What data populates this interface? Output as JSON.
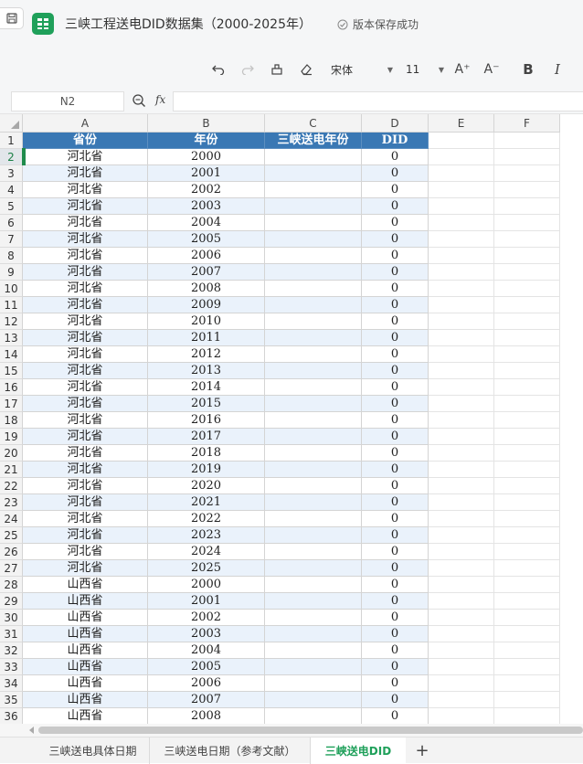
{
  "title_bar": {
    "doc_title": "三峡工程送电DID数据集（2000-2025年）",
    "save_status": "版本保存成功",
    "accent_color": "#1fa05a"
  },
  "toolbar": {
    "undo_icon": "undo-icon",
    "redo_icon": "redo-icon",
    "format_painter_icon": "format-painter-icon",
    "clear_format_icon": "eraser-icon",
    "font_name": "宋体",
    "font_size": "11",
    "increase_font_label": "A⁺",
    "decrease_font_label": "A⁻",
    "bold_label": "B",
    "italic_label": "I"
  },
  "formula_bar": {
    "cell_ref": "N2",
    "fx_label": "fx",
    "formula_value": ""
  },
  "grid": {
    "columns": [
      "A",
      "B",
      "C",
      "D",
      "E",
      "F"
    ],
    "rows": [
      "1",
      "2",
      "3",
      "4",
      "5",
      "6",
      "7",
      "8",
      "9",
      "10",
      "11",
      "12",
      "13",
      "14",
      "15",
      "16",
      "17",
      "18",
      "19",
      "20",
      "21",
      "22",
      "23",
      "24",
      "25",
      "26",
      "27",
      "28",
      "29",
      "30",
      "31",
      "32",
      "33",
      "34",
      "35",
      "36"
    ],
    "header_color": "#3a78b4",
    "stripe_color": "#eaf2fb",
    "header_row": [
      "省份",
      "年份",
      "三峡送电年份",
      "DID"
    ],
    "data": [
      [
        "河北省",
        "2000",
        "",
        "0"
      ],
      [
        "河北省",
        "2001",
        "",
        "0"
      ],
      [
        "河北省",
        "2002",
        "",
        "0"
      ],
      [
        "河北省",
        "2003",
        "",
        "0"
      ],
      [
        "河北省",
        "2004",
        "",
        "0"
      ],
      [
        "河北省",
        "2005",
        "",
        "0"
      ],
      [
        "河北省",
        "2006",
        "",
        "0"
      ],
      [
        "河北省",
        "2007",
        "",
        "0"
      ],
      [
        "河北省",
        "2008",
        "",
        "0"
      ],
      [
        "河北省",
        "2009",
        "",
        "0"
      ],
      [
        "河北省",
        "2010",
        "",
        "0"
      ],
      [
        "河北省",
        "2011",
        "",
        "0"
      ],
      [
        "河北省",
        "2012",
        "",
        "0"
      ],
      [
        "河北省",
        "2013",
        "",
        "0"
      ],
      [
        "河北省",
        "2014",
        "",
        "0"
      ],
      [
        "河北省",
        "2015",
        "",
        "0"
      ],
      [
        "河北省",
        "2016",
        "",
        "0"
      ],
      [
        "河北省",
        "2017",
        "",
        "0"
      ],
      [
        "河北省",
        "2018",
        "",
        "0"
      ],
      [
        "河北省",
        "2019",
        "",
        "0"
      ],
      [
        "河北省",
        "2020",
        "",
        "0"
      ],
      [
        "河北省",
        "2021",
        "",
        "0"
      ],
      [
        "河北省",
        "2022",
        "",
        "0"
      ],
      [
        "河北省",
        "2023",
        "",
        "0"
      ],
      [
        "河北省",
        "2024",
        "",
        "0"
      ],
      [
        "河北省",
        "2025",
        "",
        "0"
      ],
      [
        "山西省",
        "2000",
        "",
        "0"
      ],
      [
        "山西省",
        "2001",
        "",
        "0"
      ],
      [
        "山西省",
        "2002",
        "",
        "0"
      ],
      [
        "山西省",
        "2003",
        "",
        "0"
      ],
      [
        "山西省",
        "2004",
        "",
        "0"
      ],
      [
        "山西省",
        "2005",
        "",
        "0"
      ],
      [
        "山西省",
        "2006",
        "",
        "0"
      ],
      [
        "山西省",
        "2007",
        "",
        "0"
      ],
      [
        "山西省",
        "2008",
        "",
        "0"
      ]
    ]
  },
  "sheets": {
    "tabs": [
      "三峡送电具体日期",
      "三峡送电日期（参考文献）",
      "三峡送电DID"
    ],
    "active": "三峡送电DID",
    "add_label": "+"
  }
}
